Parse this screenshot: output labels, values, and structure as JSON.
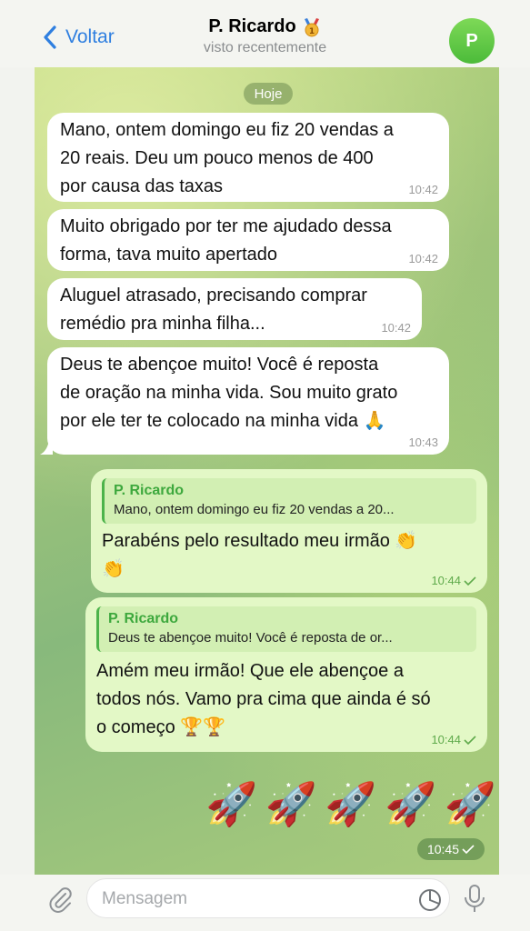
{
  "header": {
    "back_label": "Voltar",
    "contact_name": "P. Ricardo",
    "status": "visto recentemente",
    "avatar_letter": "P",
    "medal_emoji": "🥇"
  },
  "chat": {
    "date_label": "Hoje",
    "incoming": [
      {
        "lines": [
          "Mano, ontem domingo eu fiz 20 vendas a",
          "20 reais. Deu um pouco menos de 400",
          "por causa das taxas"
        ],
        "time": "10:42"
      },
      {
        "lines": [
          "Muito obrigado por ter me ajudado dessa",
          "forma, tava muito apertado"
        ],
        "time": "10:42"
      },
      {
        "lines": [
          "Aluguel atrasado, precisando comprar",
          "remédio pra minha filha..."
        ],
        "time": "10:42"
      },
      {
        "lines": [
          "Deus te abençoe muito! Você é reposta",
          "de oração na minha vida. Sou muito grato",
          "por ele ter te colocado na minha vida 🙏"
        ],
        "time": "10:43"
      }
    ],
    "outgoing": [
      {
        "reply_name": "P. Ricardo",
        "reply_text": "Mano, ontem domingo eu fiz 20 vendas a 20...",
        "lines": [
          "Parabéns pelo resultado meu irmão 👏",
          "👏"
        ],
        "time": "10:44"
      },
      {
        "reply_name": "P. Ricardo",
        "reply_text": "Deus te abençoe muito! Você é reposta de or...",
        "lines": [
          "Amém meu irmão! Que ele abençoe a",
          "todos nós. Vamo pra cima que ainda é só",
          "o começo 🏆🏆"
        ],
        "time": "10:44"
      }
    ],
    "rockets": [
      "🚀",
      "🚀",
      "🚀",
      "🚀",
      "🚀"
    ],
    "rockets_time": "10:45"
  },
  "composer": {
    "placeholder": "Mensagem"
  },
  "colors": {
    "accent_blue": "#2f7fe0",
    "outgoing_bubble": "#e3f8c6",
    "reply_green": "#3da83d"
  },
  "icons": [
    "chevron-left-icon",
    "paperclip-icon",
    "sticker-icon",
    "microphone-icon",
    "read-check-icon"
  ]
}
